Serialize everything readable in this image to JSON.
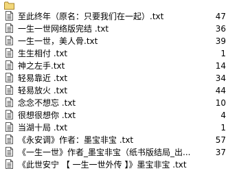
{
  "parent_folder": {
    "icon": "folder-icon",
    "label": ""
  },
  "files": [
    {
      "name": "至此终年（原名：只要我们在一起）.txt",
      "size": "47"
    },
    {
      "name": "一生一世网络版完结 .txt",
      "size": "36"
    },
    {
      "name": "一生一世，美人骨.txt",
      "size": "39"
    },
    {
      "name": "生生相付 .txt",
      "size": "1"
    },
    {
      "name": "神之左手.txt",
      "size": "14"
    },
    {
      "name": "轻易靠近 .txt",
      "size": "34"
    },
    {
      "name": "轻易放火 .txt",
      "size": "44"
    },
    {
      "name": "念念不想忘 .txt",
      "size": "10"
    },
    {
      "name": "很想很想你 .txt",
      "size": "4"
    },
    {
      "name": "当湖十局 .txt",
      "size": "1"
    },
    {
      "name": "《永安调》作者：墨宝非宝 .txt",
      "size": "57"
    },
    {
      "name": "《一生一世》作者_墨宝非宝（纸书版结局_出...",
      "size": "37"
    },
    {
      "name": "《此世安宁 【 一生一世外传 】》墨宝非宝 .txt",
      "size": ""
    }
  ],
  "file_icon": "text-file-icon",
  "colors": {
    "folder": "#e8c860",
    "background": "#ffffff"
  }
}
